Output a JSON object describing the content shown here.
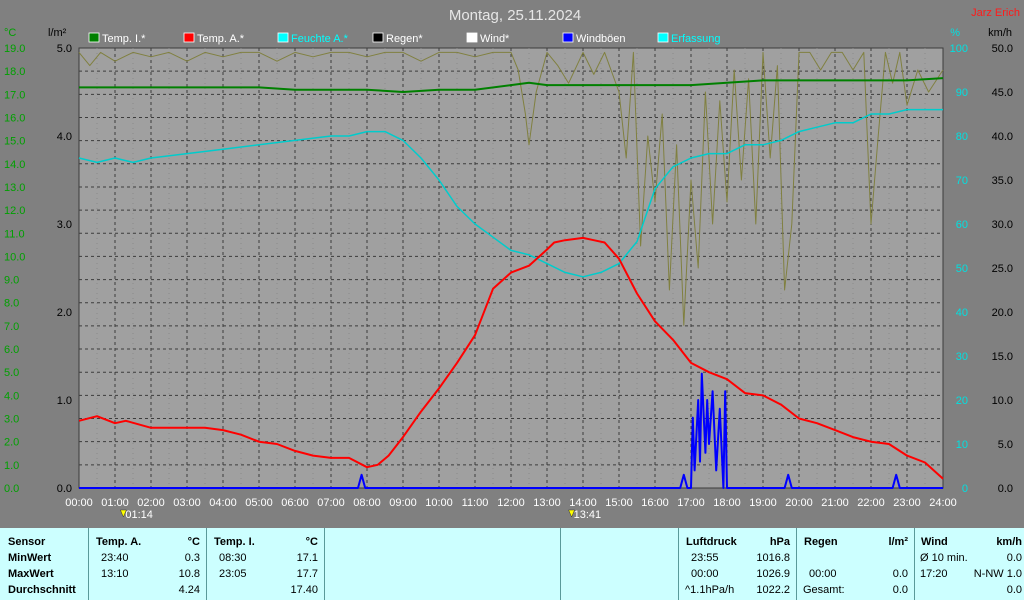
{
  "header": {
    "title": "Montag, 25.11.2024",
    "author": "Jarz Erich"
  },
  "chart_data": {
    "type": "line",
    "title": "Montag, 25.11.2024",
    "x_ticks": [
      "00:00",
      "01:00",
      "02:00",
      "03:00",
      "04:00",
      "05:00",
      "06:00",
      "07:00",
      "08:00",
      "09:00",
      "10:00",
      "11:00",
      "12:00",
      "13:00",
      "14:00",
      "15:00",
      "16:00",
      "17:00",
      "18:00",
      "19:00",
      "20:00",
      "21:00",
      "22:00",
      "23:00",
      "24:00"
    ],
    "xlim": [
      0,
      24
    ],
    "axis_units": {
      "temp": "°C",
      "rain": "l/m²",
      "humidity": "%",
      "wind": "km/h"
    },
    "temp_ticks": [
      "0.0",
      "1.0",
      "2.0",
      "3.0",
      "4.0",
      "5.0",
      "6.0",
      "7.0",
      "8.0",
      "9.0",
      "10.0",
      "11.0",
      "12.0",
      "13.0",
      "14.0",
      "15.0",
      "16.0",
      "17.0",
      "18.0",
      "19.0"
    ],
    "temp_lim": [
      0,
      19
    ],
    "rain_ticks": [
      "0.0",
      "1.0",
      "2.0",
      "3.0",
      "4.0",
      "5.0"
    ],
    "rain_lim": [
      0,
      5
    ],
    "humidity_ticks": [
      "0",
      "10",
      "20",
      "30",
      "40",
      "50",
      "60",
      "70",
      "80",
      "90",
      "100"
    ],
    "humidity_lim": [
      0,
      100
    ],
    "wind_ticks": [
      "0.0",
      "5.0",
      "10.0",
      "15.0",
      "20.0",
      "25.0",
      "30.0",
      "35.0",
      "40.0",
      "45.0",
      "50.0"
    ],
    "wind_lim": [
      0,
      50
    ],
    "grid": true,
    "legend_position": "top",
    "legend": [
      {
        "label": "Temp. I.*",
        "color": "#008000"
      },
      {
        "label": "Temp. A.*",
        "color": "#ff0000"
      },
      {
        "label": "Feuchte A.*",
        "color": "#00ffff"
      },
      {
        "label": "Regen*",
        "color": "#000000"
      },
      {
        "label": "Wind*",
        "color": "#ffffff"
      },
      {
        "label": "Windböen",
        "color": "#0000ff"
      },
      {
        "label": "Erfassung",
        "color": "#00ffff"
      }
    ],
    "markers": [
      {
        "time": "01:14",
        "hour": 1.233
      },
      {
        "time": "13:41",
        "hour": 13.683
      }
    ],
    "series": [
      {
        "name": "Temp. I.*",
        "axis": "temp",
        "color": "#008000",
        "width": 2,
        "x": [
          0,
          1,
          2,
          3,
          4,
          5,
          6,
          7,
          8,
          9,
          10,
          11,
          12,
          12.5,
          13,
          14,
          15,
          16,
          17,
          18,
          19,
          20,
          21,
          22,
          23,
          24
        ],
        "y": [
          17.3,
          17.3,
          17.3,
          17.3,
          17.3,
          17.3,
          17.2,
          17.2,
          17.2,
          17.1,
          17.2,
          17.2,
          17.4,
          17.5,
          17.4,
          17.4,
          17.4,
          17.4,
          17.4,
          17.5,
          17.6,
          17.6,
          17.6,
          17.6,
          17.6,
          17.7
        ]
      },
      {
        "name": "Temp. A.*",
        "axis": "temp",
        "color": "#ff0000",
        "width": 2,
        "x": [
          0,
          0.5,
          1,
          1.3,
          2,
          2.5,
          3,
          3.5,
          4,
          4.5,
          5,
          5.5,
          6,
          6.5,
          7,
          7.5,
          8,
          8.3,
          8.6,
          9,
          9.5,
          10,
          10.5,
          11,
          11.5,
          12,
          12.5,
          13,
          13.2,
          13.5,
          14,
          14.3,
          14.6,
          15,
          15.5,
          16,
          16.5,
          17,
          17.5,
          18,
          18.5,
          19,
          19.5,
          20,
          20.5,
          21,
          21.5,
          22,
          22.5,
          23,
          23.5,
          24
        ],
        "y": [
          2.9,
          3.1,
          2.8,
          2.9,
          2.6,
          2.6,
          2.6,
          2.6,
          2.5,
          2.3,
          2.0,
          1.9,
          1.6,
          1.4,
          1.3,
          1.3,
          0.9,
          1.0,
          1.4,
          2.2,
          3.3,
          4.3,
          5.4,
          6.6,
          8.6,
          9.3,
          9.6,
          10.3,
          10.6,
          10.7,
          10.8,
          10.7,
          10.6,
          9.9,
          8.4,
          7.2,
          6.4,
          5.4,
          5.0,
          4.7,
          4.1,
          4.0,
          3.6,
          3.0,
          2.8,
          2.5,
          2.2,
          2.0,
          1.9,
          1.4,
          1.1,
          0.4
        ]
      },
      {
        "name": "Feuchte A.*",
        "axis": "humidity",
        "color": "#00cccc",
        "width": 1.5,
        "x": [
          0,
          0.5,
          1,
          1.5,
          2,
          3,
          4,
          5,
          6,
          7,
          7.5,
          8,
          8.5,
          9,
          9.5,
          10,
          10.5,
          11,
          11.5,
          12,
          12.5,
          13,
          13.5,
          14,
          14.5,
          15,
          15.5,
          16,
          16.5,
          17,
          17.5,
          18,
          18.5,
          19,
          19.5,
          20,
          20.5,
          21,
          21.5,
          22,
          22.5,
          23,
          23.5,
          24
        ],
        "y": [
          75,
          74,
          75,
          74,
          75,
          76,
          77,
          78,
          79,
          80,
          80,
          81,
          81,
          79,
          75,
          70,
          64,
          60,
          57,
          54,
          53,
          51,
          49,
          48,
          49,
          51,
          56,
          68,
          73,
          75,
          76,
          76,
          78,
          78,
          79,
          81,
          82,
          83,
          83,
          85,
          85,
          86,
          86,
          86
        ]
      },
      {
        "name": "Windböen",
        "axis": "wind",
        "color": "#0000ff",
        "width": 2,
        "x": [
          0,
          7.75,
          7.85,
          7.95,
          16.7,
          16.8,
          16.9,
          17.0,
          17.05,
          17.1,
          17.2,
          17.25,
          17.3,
          17.4,
          17.45,
          17.5,
          17.6,
          17.7,
          17.8,
          17.9,
          17.95,
          18.0,
          19.6,
          19.7,
          19.8,
          22.6,
          22.7,
          22.8,
          24
        ],
        "y": [
          0,
          0,
          1.5,
          0,
          0,
          1.5,
          0,
          0,
          8,
          2,
          10,
          3,
          13,
          4,
          10,
          5,
          11,
          2,
          9,
          0,
          11,
          0,
          0,
          1.5,
          0,
          0,
          1.5,
          0,
          0
        ]
      },
      {
        "name": "Erfassung",
        "axis": "humidity",
        "color": "#808040",
        "width": 1,
        "x": [
          0,
          0.3,
          0.6,
          1,
          1.5,
          2,
          2.5,
          3,
          3.5,
          4,
          4.5,
          5,
          5.5,
          6,
          6.5,
          7,
          7.5,
          8,
          8.5,
          9,
          9.5,
          10,
          10.5,
          11,
          11.5,
          12,
          12.2,
          12.4,
          12.5,
          12.7,
          13,
          13.3,
          13.6,
          14,
          14.3,
          14.6,
          15,
          15.2,
          15.4,
          15.6,
          15.8,
          16,
          16.2,
          16.4,
          16.6,
          16.8,
          17,
          17.2,
          17.4,
          17.6,
          17.8,
          18,
          18.2,
          18.4,
          18.6,
          18.8,
          19,
          19.2,
          19.4,
          19.6,
          19.8,
          20,
          20.3,
          20.6,
          20.9,
          21.2,
          21.5,
          21.8,
          22,
          22.2,
          22.4,
          22.6,
          22.8,
          23,
          23.3,
          23.6,
          24
        ],
        "y": [
          99,
          96,
          99,
          97,
          99,
          98,
          99,
          97,
          99,
          98,
          99,
          99,
          97,
          99,
          98,
          99,
          99,
          98,
          99,
          99,
          97,
          99,
          99,
          98,
          99,
          99,
          95,
          85,
          78,
          90,
          99,
          96,
          92,
          99,
          94,
          99,
          90,
          75,
          99,
          55,
          80,
          65,
          85,
          45,
          78,
          37,
          70,
          50,
          90,
          60,
          88,
          65,
          95,
          70,
          93,
          60,
          99,
          75,
          96,
          45,
          60,
          99,
          99,
          95,
          99,
          99,
          95,
          99,
          60,
          80,
          99,
          92,
          99,
          87,
          95,
          90,
          95
        ]
      }
    ]
  },
  "table": {
    "sensor": {
      "label": "Sensor",
      "rows": [
        "MinWert",
        "MaxWert",
        "Durchschnitt"
      ]
    },
    "temp_a": {
      "label": "Temp. A.",
      "unit": "°C",
      "rows": [
        {
          "time": "23:40",
          "value": "0.3"
        },
        {
          "time": "13:10",
          "value": "10.8"
        },
        {
          "time": "",
          "value": "4.24"
        }
      ]
    },
    "temp_i": {
      "label": "Temp. I.",
      "unit": "°C",
      "rows": [
        {
          "time": "08:30",
          "value": "17.1"
        },
        {
          "time": "23:05",
          "value": "17.7"
        },
        {
          "time": "",
          "value": "17.40"
        }
      ]
    },
    "pressure": {
      "label": "Luftdruck",
      "unit": "hPa",
      "rows": [
        {
          "time": "23:55",
          "value": "1016.8"
        },
        {
          "time": "00:00",
          "value": "1026.9"
        },
        {
          "time": "^1.1hPa/h",
          "value": "1022.2"
        }
      ]
    },
    "rain": {
      "label": "Regen",
      "unit": "l/m²",
      "rows": [
        {
          "time": "",
          "value": ""
        },
        {
          "time": "00:00",
          "value": "0.0"
        },
        {
          "time": "Gesamt:",
          "value": "0.0"
        }
      ]
    },
    "wind": {
      "label": "Wind",
      "unit": "km/h",
      "rows": [
        {
          "time": "Ø 10 min.",
          "value": "0.0"
        },
        {
          "time": "17:20",
          "value": "N-NW 1.0"
        },
        {
          "time": "",
          "value": "0.0"
        }
      ]
    }
  }
}
